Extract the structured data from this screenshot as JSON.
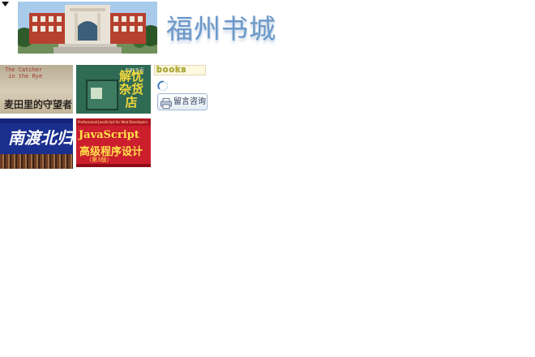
{
  "header": {
    "site_title": "福州书城",
    "menu_icon": "triangle-down-icon",
    "banner_image": "library-building-photo"
  },
  "books": [
    {
      "title_en": "The Catcher\n in the Rye",
      "title_cn": "麦田里的守望者"
    },
    {
      "author": "东野圭吾",
      "title_cn": "解忧杂货店"
    },
    {
      "title_cn": "南渡北归"
    },
    {
      "title_en_small": "Professional JavaScript for Web Developers",
      "title_js": "JavaScript",
      "title_cn": "高级程序设计",
      "edition": "（第3版）"
    }
  ],
  "sidebar": {
    "logo_text": "books",
    "spinner_icon": "spinner-icon",
    "consult_button_label": "留言咨询",
    "consult_icon": "printer-icon"
  },
  "colors": {
    "title_blue": "#6b98c8",
    "book1_bg": "#c8bda6",
    "book2_bg": "#2f6a54",
    "book3_bg": "#1b2f8f",
    "book4_bg": "#cc1f2e"
  }
}
